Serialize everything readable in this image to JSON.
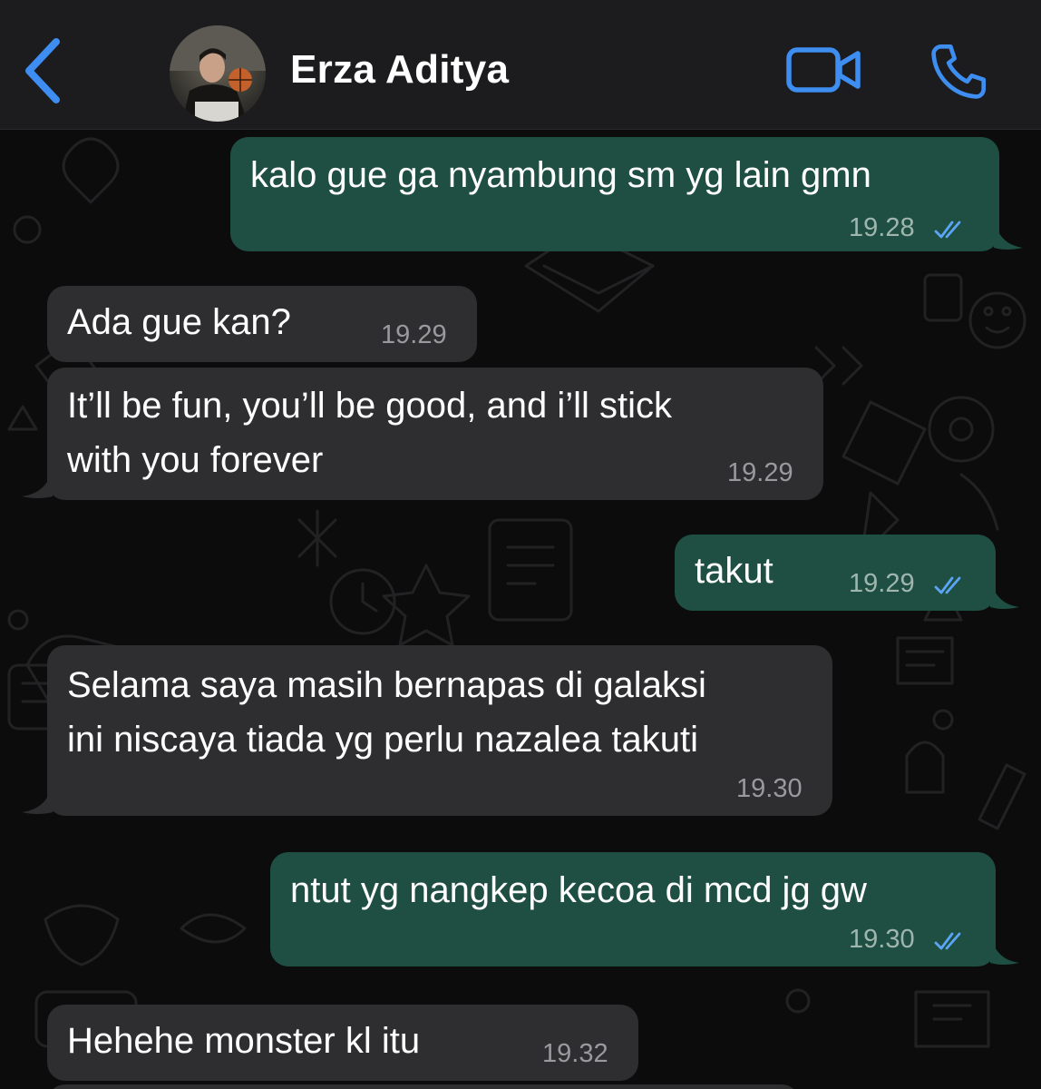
{
  "header": {
    "contact_name": "Erza Aditya"
  },
  "icons": {
    "back": "chevron-left-icon",
    "video": "video-camera-icon",
    "call": "phone-icon",
    "read_receipt": "double-check-icon"
  },
  "colors": {
    "accent": "#3d8ef0",
    "outgoing_bubble": "#1f4f42",
    "incoming_bubble": "#2e2e30",
    "read_ticks": "#5aa6f5"
  },
  "messages": [
    {
      "direction": "out",
      "lines": [
        "kalo gue ga nyambung sm yg lain gmn"
      ],
      "time": "19.28",
      "read": true
    },
    {
      "direction": "in",
      "lines": [
        "Ada gue kan?"
      ],
      "time": "19.29"
    },
    {
      "direction": "in",
      "lines": [
        "It’ll be fun, you’ll be good, and i’ll stick",
        "with you forever"
      ],
      "time": "19.29"
    },
    {
      "direction": "out",
      "lines": [
        "takut"
      ],
      "time": "19.29",
      "read": true
    },
    {
      "direction": "in",
      "lines": [
        "Selama saya masih bernapas di galaksi",
        "ini niscaya tiada yg perlu nazalea takuti"
      ],
      "time": "19.30"
    },
    {
      "direction": "out",
      "lines": [
        "ntut yg nangkep kecoa di mcd jg gw"
      ],
      "time": "19.30",
      "read": true
    },
    {
      "direction": "in",
      "lines": [
        "Hehehe monster kl itu"
      ],
      "time": "19.32"
    }
  ]
}
